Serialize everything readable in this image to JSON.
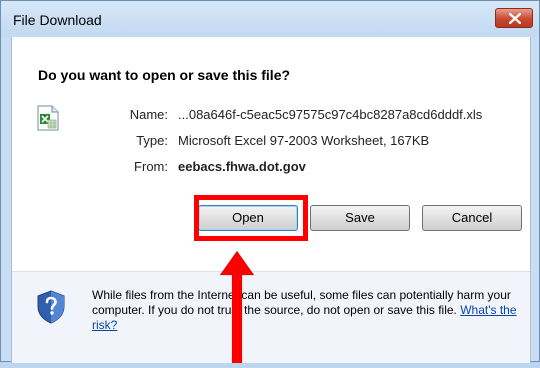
{
  "dialog": {
    "title": "File Download",
    "question": "Do you want to open or save this file?",
    "name_label": "Name:",
    "name_value": "...08a646f-c5eac5c97575c97c4bc8287a8cd6dddf.xls",
    "type_label": "Type:",
    "type_value": "Microsoft Excel 97-2003 Worksheet, 167KB",
    "from_label": "From:",
    "from_value": "eebacs.fhwa.dot.gov",
    "buttons": {
      "open": "Open",
      "save": "Save",
      "cancel": "Cancel"
    },
    "warning_text": "While files from the Internet can be useful, some files can potentially harm your computer. If you do not trust the source, do not open or save this file.",
    "warning_link": "What's the risk?"
  },
  "icons": {
    "file": "excel-file-icon",
    "shield": "security-shield-question-icon",
    "close": "close-icon",
    "arrow": "red-arrow-up-icon"
  },
  "colors": {
    "highlight": "#ff0000",
    "close_button": "#c8492f",
    "link": "#0645ad",
    "title_bar": "#c2d9f1"
  }
}
